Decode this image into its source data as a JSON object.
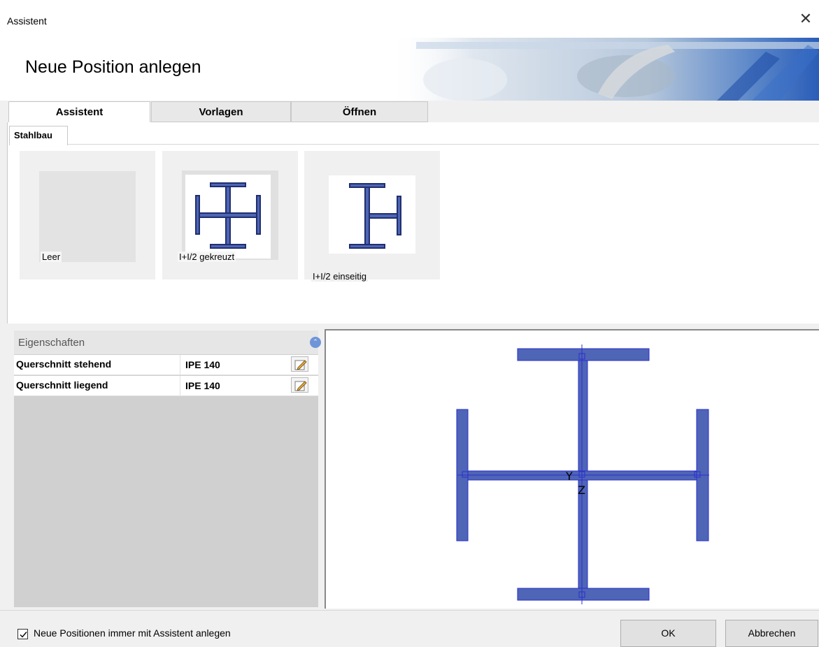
{
  "window": {
    "title": "Assistent",
    "close_glyph": "✕"
  },
  "header": {
    "heading": "Neue Position anlegen"
  },
  "tabs": [
    {
      "label": "Assistent",
      "active": true
    },
    {
      "label": "Vorlagen",
      "active": false
    },
    {
      "label": "Öffnen",
      "active": false
    }
  ],
  "subtab": {
    "label": "Stahlbau"
  },
  "templates": [
    {
      "label": "Leer",
      "icon": "empty-icon"
    },
    {
      "label": "I+I/2 gekreuzt",
      "icon": "crossed-i-beam-icon"
    },
    {
      "label": "I+I/2 einseitig",
      "icon": "one-sided-i-beam-icon"
    }
  ],
  "properties": {
    "title": "Eigenschaften",
    "rows": [
      {
        "name": "Querschnitt stehend",
        "value": "IPE 140"
      },
      {
        "name": "Querschnitt liegend",
        "value": "IPE 140"
      }
    ]
  },
  "preview": {
    "axis_y": "Y",
    "axis_z": "Z",
    "beam_color": "#4f65b5"
  },
  "footer": {
    "checkbox_label": "Neue Positionen immer mit Assistent anlegen",
    "checkbox_checked": true,
    "ok_label": "OK",
    "cancel_label": "Abbrechen"
  }
}
